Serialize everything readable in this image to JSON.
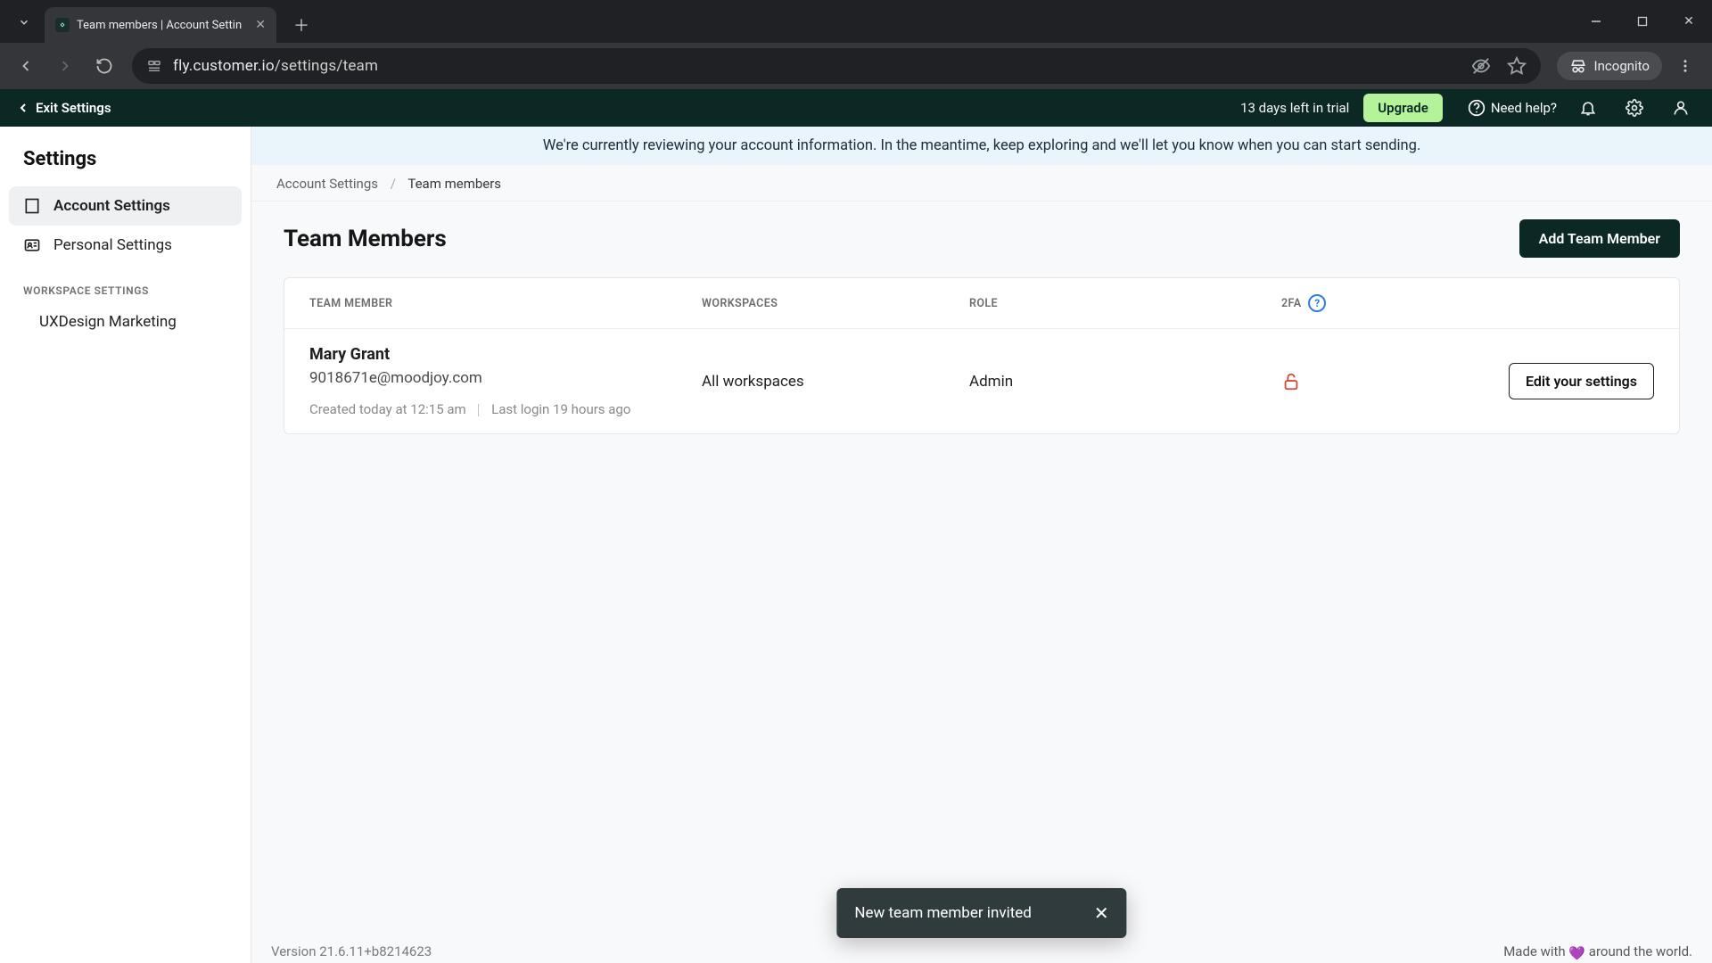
{
  "browser": {
    "tab_title": "Team members | Account Settin",
    "url_host": "fly.customer.io",
    "url_path": "/settings/team",
    "incognito_label": "Incognito"
  },
  "topbar": {
    "exit_label": "Exit Settings",
    "trial_text": "13 days left in trial",
    "upgrade_label": "Upgrade",
    "help_label": "Need help?"
  },
  "sidebar": {
    "heading": "Settings",
    "items": [
      {
        "label": "Account Settings",
        "active": true
      },
      {
        "label": "Personal Settings",
        "active": false
      }
    ],
    "section_label": "WORKSPACE SETTINGS",
    "workspace": "UXDesign Marketing"
  },
  "banner": "We're currently reviewing your account information. In the meantime, keep exploring and we'll let you know when you can start sending.",
  "breadcrumbs": {
    "root": "Account Settings",
    "current": "Team members"
  },
  "page": {
    "title": "Team Members",
    "add_button": "Add Team Member"
  },
  "table": {
    "headers": {
      "member": "TEAM MEMBER",
      "workspaces": "WORKSPACES",
      "role": "ROLE",
      "twofa": "2FA"
    },
    "rows": [
      {
        "name": "Mary Grant",
        "email": "9018671e@moodjoy.com",
        "created": "Created today at 12:15 am",
        "last_login": "Last login 19 hours ago",
        "workspaces": "All workspaces",
        "role": "Admin",
        "twofa_enabled": false,
        "action_label": "Edit your settings"
      }
    ]
  },
  "toast": {
    "message": "New team member invited"
  },
  "footer": {
    "version": "Version 21.6.11+b8214623",
    "made_prefix": "Made with ",
    "made_suffix": " around the world."
  }
}
